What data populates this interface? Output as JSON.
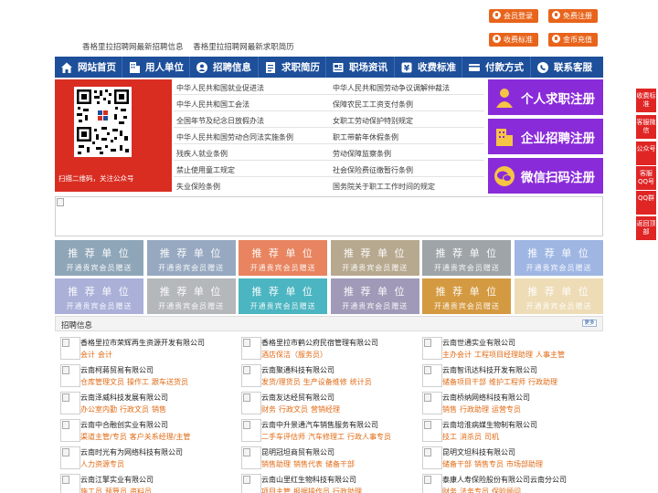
{
  "header": {
    "links": [
      "香格里拉招聘网最新招聘信息",
      "香格里拉招聘网最新求职简历"
    ],
    "buttons": [
      {
        "label": "会员登录",
        "icon": "user-icon"
      },
      {
        "label": "免费注册",
        "icon": "register-icon"
      },
      {
        "label": "收费标准",
        "icon": "price-icon"
      },
      {
        "label": "金币充值",
        "icon": "coin-icon"
      }
    ],
    "accent": "#e8641b"
  },
  "nav": {
    "items": [
      {
        "label": "网站首页",
        "icon": "home-icon"
      },
      {
        "label": "用人单位",
        "icon": "building-icon"
      },
      {
        "label": "招聘信息",
        "icon": "recruit-icon"
      },
      {
        "label": "求职简历",
        "icon": "resume-icon"
      },
      {
        "label": "职场资讯",
        "icon": "news-icon"
      },
      {
        "label": "收费标准",
        "icon": "fee-icon"
      },
      {
        "label": "付款方式",
        "icon": "payment-icon"
      },
      {
        "label": "联系客服",
        "icon": "service-icon"
      }
    ],
    "color": "#1d4f9a"
  },
  "qr": {
    "caption": "扫描二维码，关注公众号"
  },
  "laws": {
    "left": [
      "中华人民共和国就业促进法",
      "中华人民共和国工会法",
      "全国年节及纪念日放假办法",
      "中华人民共和国劳动合同法实施条例",
      "残疾人就业条例",
      "禁止使用童工规定",
      "失业保险条例"
    ],
    "right": [
      "中华人民共和国劳动争议调解仲裁法",
      "保障农民工工资支付条例",
      "女职工劳动保护特别规定",
      "职工带薪年休假条例",
      "劳动保障监察条例",
      "社会保险费征缴暂行条例",
      "国务院关于职工工作时间的规定"
    ]
  },
  "register": [
    {
      "label": "个人求职注册",
      "icon": "person-icon"
    },
    {
      "label": "企业招聘注册",
      "icon": "enterprise-icon"
    },
    {
      "label": "微信扫码注册",
      "icon": "wechat-icon"
    }
  ],
  "side": [
    "收费标准",
    "客服微信",
    "公众号",
    "客服QQ号",
    "QQ群",
    "返回顶部"
  ],
  "tiles": {
    "title": "推 荐 单 位",
    "subtitle": "开通贵宾会员赠送",
    "colors": [
      "#8fa6b8",
      "#97a9c1",
      "#e8845f",
      "#b7a98f",
      "#9ea4a8",
      "#9fb6e3",
      "#aab0d8",
      "#b5b8bb",
      "#4bb5c1",
      "#a09ab8",
      "#d49a41",
      "#eddcb6"
    ]
  },
  "jobs": {
    "title": "招聘信息",
    "more": "更多",
    "companies": [
      {
        "name": "香格里拉市荣辉再生资源开发有限公司",
        "jobs": [
          "会计",
          "会计"
        ]
      },
      {
        "name": "香格里拉市鹤公府民宿管理有限公司",
        "jobs": [
          "酒店保洁（服务员）"
        ]
      },
      {
        "name": "云南世通实业有限公司",
        "jobs": [
          "主办会计",
          "工程项目经理助理",
          "人事主管"
        ]
      },
      {
        "name": "云南柯蔣贸易有限公司",
        "jobs": [
          "仓库管理文员",
          "操作工",
          "跟车送货员"
        ]
      },
      {
        "name": "云南聚通科技有限公司",
        "jobs": [
          "发货/理货员",
          "生产设备维修",
          "统计员"
        ]
      },
      {
        "name": "云南智讯达科技开发有限公司",
        "jobs": [
          "储备项目干部",
          "维护工程师",
          "行政助理"
        ]
      },
      {
        "name": "云南泽威科技发展有限公司",
        "jobs": [
          "办公室内勤",
          "行政文员",
          "销售"
        ]
      },
      {
        "name": "云南友达经贸有限公司",
        "jobs": [
          "财务",
          "行政文员",
          "营销经理"
        ]
      },
      {
        "name": "云南桥纳网络科技有限公司",
        "jobs": [
          "销售",
          "行政助理",
          "运营专员"
        ]
      },
      {
        "name": "云南中合融创实业有限公司",
        "jobs": [
          "渠道主管/专员",
          "客户关系经理/主管"
        ]
      },
      {
        "name": "云南中升景通汽车销售服务有限公司",
        "jobs": [
          "二手车评估师",
          "汽车修理工",
          "行政人事专员"
        ]
      },
      {
        "name": "云南培淮病媒生物制有限公司",
        "jobs": [
          "技工",
          "消杀员",
          "司机"
        ]
      },
      {
        "name": "云南时光有为网络科技有限公司",
        "jobs": [
          "人力资源专员"
        ]
      },
      {
        "name": "昆明冠坦商贸有限公司",
        "jobs": [
          "销售助理",
          "销售代表",
          "储备干部"
        ]
      },
      {
        "name": "昆明文坦科技有限公司",
        "jobs": [
          "储备干部",
          "销售专员",
          "市场部助理"
        ]
      },
      {
        "name": "云南江擎实业有限公司",
        "jobs": [
          "施工员",
          "预算员",
          "资料员"
        ]
      },
      {
        "name": "云南山里红生物科技有限公司",
        "jobs": [
          "项目主管",
          "报据操作员",
          "行政助理"
        ]
      },
      {
        "name": "泰康人寿保险股份有限公司云南分公司",
        "jobs": [
          "财务",
          "法务专员",
          "保险顾问"
        ]
      }
    ]
  }
}
